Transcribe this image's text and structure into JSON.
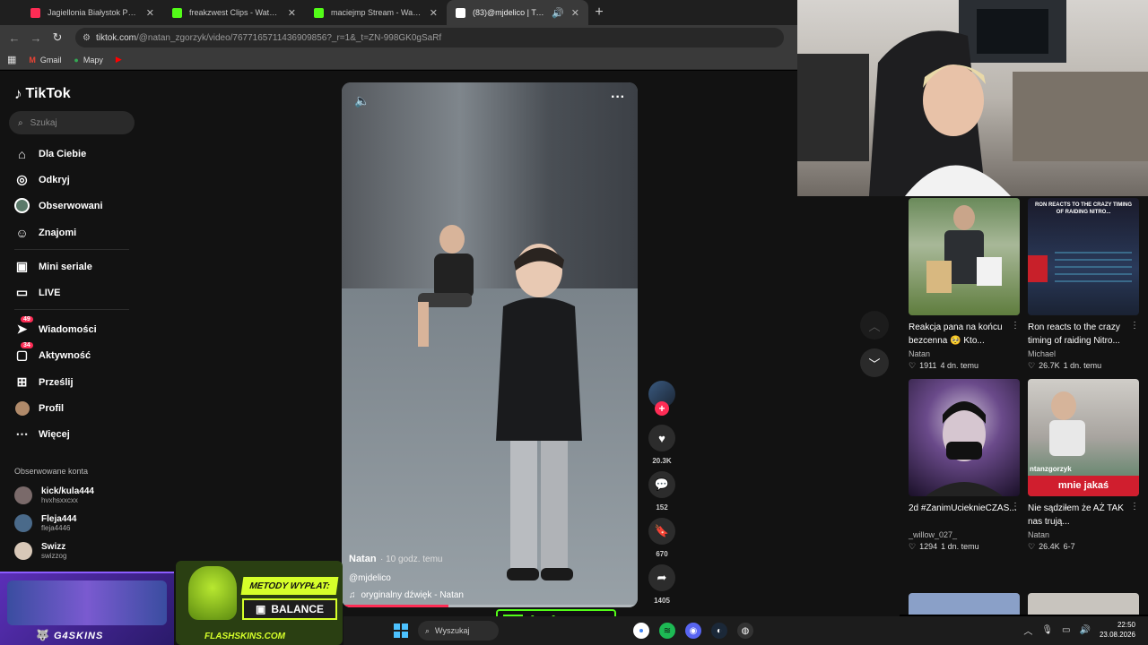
{
  "browser": {
    "tabs": [
      {
        "title": "Jagiellonia Białystok PFR (@jag",
        "favicon_color": "#fe2c55"
      },
      {
        "title": "freakzwest Clips - Watch Live o",
        "favicon_color": "#53fc18"
      },
      {
        "title": "maciejmp Stream - Watch Live",
        "favicon_color": "#53fc18"
      },
      {
        "title": "(83)@mjdelico | TikTok",
        "favicon_color": "#ffffff"
      }
    ],
    "url_host": "tiktok.com",
    "url_rest": "/@natan_zgorzyk/video/7677165711436909856?_r=1&_t=ZN-998GK0gSaRf",
    "bookmarks": [
      "Gmail",
      "Mapy"
    ]
  },
  "sidebar": {
    "brand": "TikTok",
    "search_placeholder": "Szukaj",
    "nav": [
      {
        "label": "Dla Ciebie",
        "icon": "home-icon"
      },
      {
        "label": "Odkryj",
        "icon": "compass-icon"
      },
      {
        "label": "Obserwowani",
        "icon": "following-icon"
      },
      {
        "label": "Znajomi",
        "icon": "friends-icon"
      },
      {
        "label": "Mini seriale",
        "icon": "series-icon"
      },
      {
        "label": "LIVE",
        "icon": "live-icon"
      },
      {
        "label": "Wiadomości",
        "icon": "messages-icon",
        "badge": "49"
      },
      {
        "label": "Aktywność",
        "icon": "activity-icon",
        "badge": "34"
      },
      {
        "label": "Prześlij",
        "icon": "upload-icon"
      },
      {
        "label": "Profil",
        "icon": "profile-icon"
      },
      {
        "label": "Więcej",
        "icon": "more-icon"
      }
    ],
    "followed_title": "Obserwowane konta",
    "followed": [
      {
        "name": "kick/kula444",
        "handle": "hvxhsxxcxx"
      },
      {
        "name": "Fleja444",
        "handle": "fleja4446"
      },
      {
        "name": "Swizz",
        "handle": "swizzog"
      }
    ]
  },
  "video": {
    "author": "Natan",
    "time": "· 10 godz. temu",
    "handle": "@mjdelico",
    "sound": "oryginalny dźwięk - Natan",
    "progress": 0.36
  },
  "actions": {
    "likes": "20.3K",
    "comments": "152",
    "saves": "670",
    "shares": "1405"
  },
  "grid": [
    {
      "title": "Reakcja pana na końcu bezcenna 🥺 Kto...",
      "author": "Natan",
      "views": "1911",
      "ago": "4 dn. temu",
      "overlay": ""
    },
    {
      "title": "Ron reacts to the crazy timing of raiding Nitro...",
      "author": "Michael",
      "views": "26.7K",
      "ago": "1 dn. temu",
      "overlay": "RON REACTS TO THE CRAZY TIMING OF RAIDING NITRO..."
    },
    {
      "title": "2d #ZanimUcieknieCZAS...",
      "author": "_willow_027_",
      "views": "1294",
      "ago": "1 dn. temu",
      "overlay": ""
    },
    {
      "title": "Nie sądziłem że AŻ TAK nas trują...",
      "author": "Natan",
      "views": "26.4K",
      "ago": "6-7",
      "overlay": "mnie jakaś",
      "overlay_handle": "ntanzgorzyk"
    }
  ],
  "overlays": {
    "g4skins": "G4SKINS",
    "flash_top": "METODY WYPŁAT:",
    "flash_balance": "BALANCE",
    "flash_site": "FLASHSKINS.COM",
    "kick_name": "kula444"
  },
  "taskbar": {
    "search": "Wyszukaj",
    "time": "22:50",
    "date": "23.08.2026"
  }
}
